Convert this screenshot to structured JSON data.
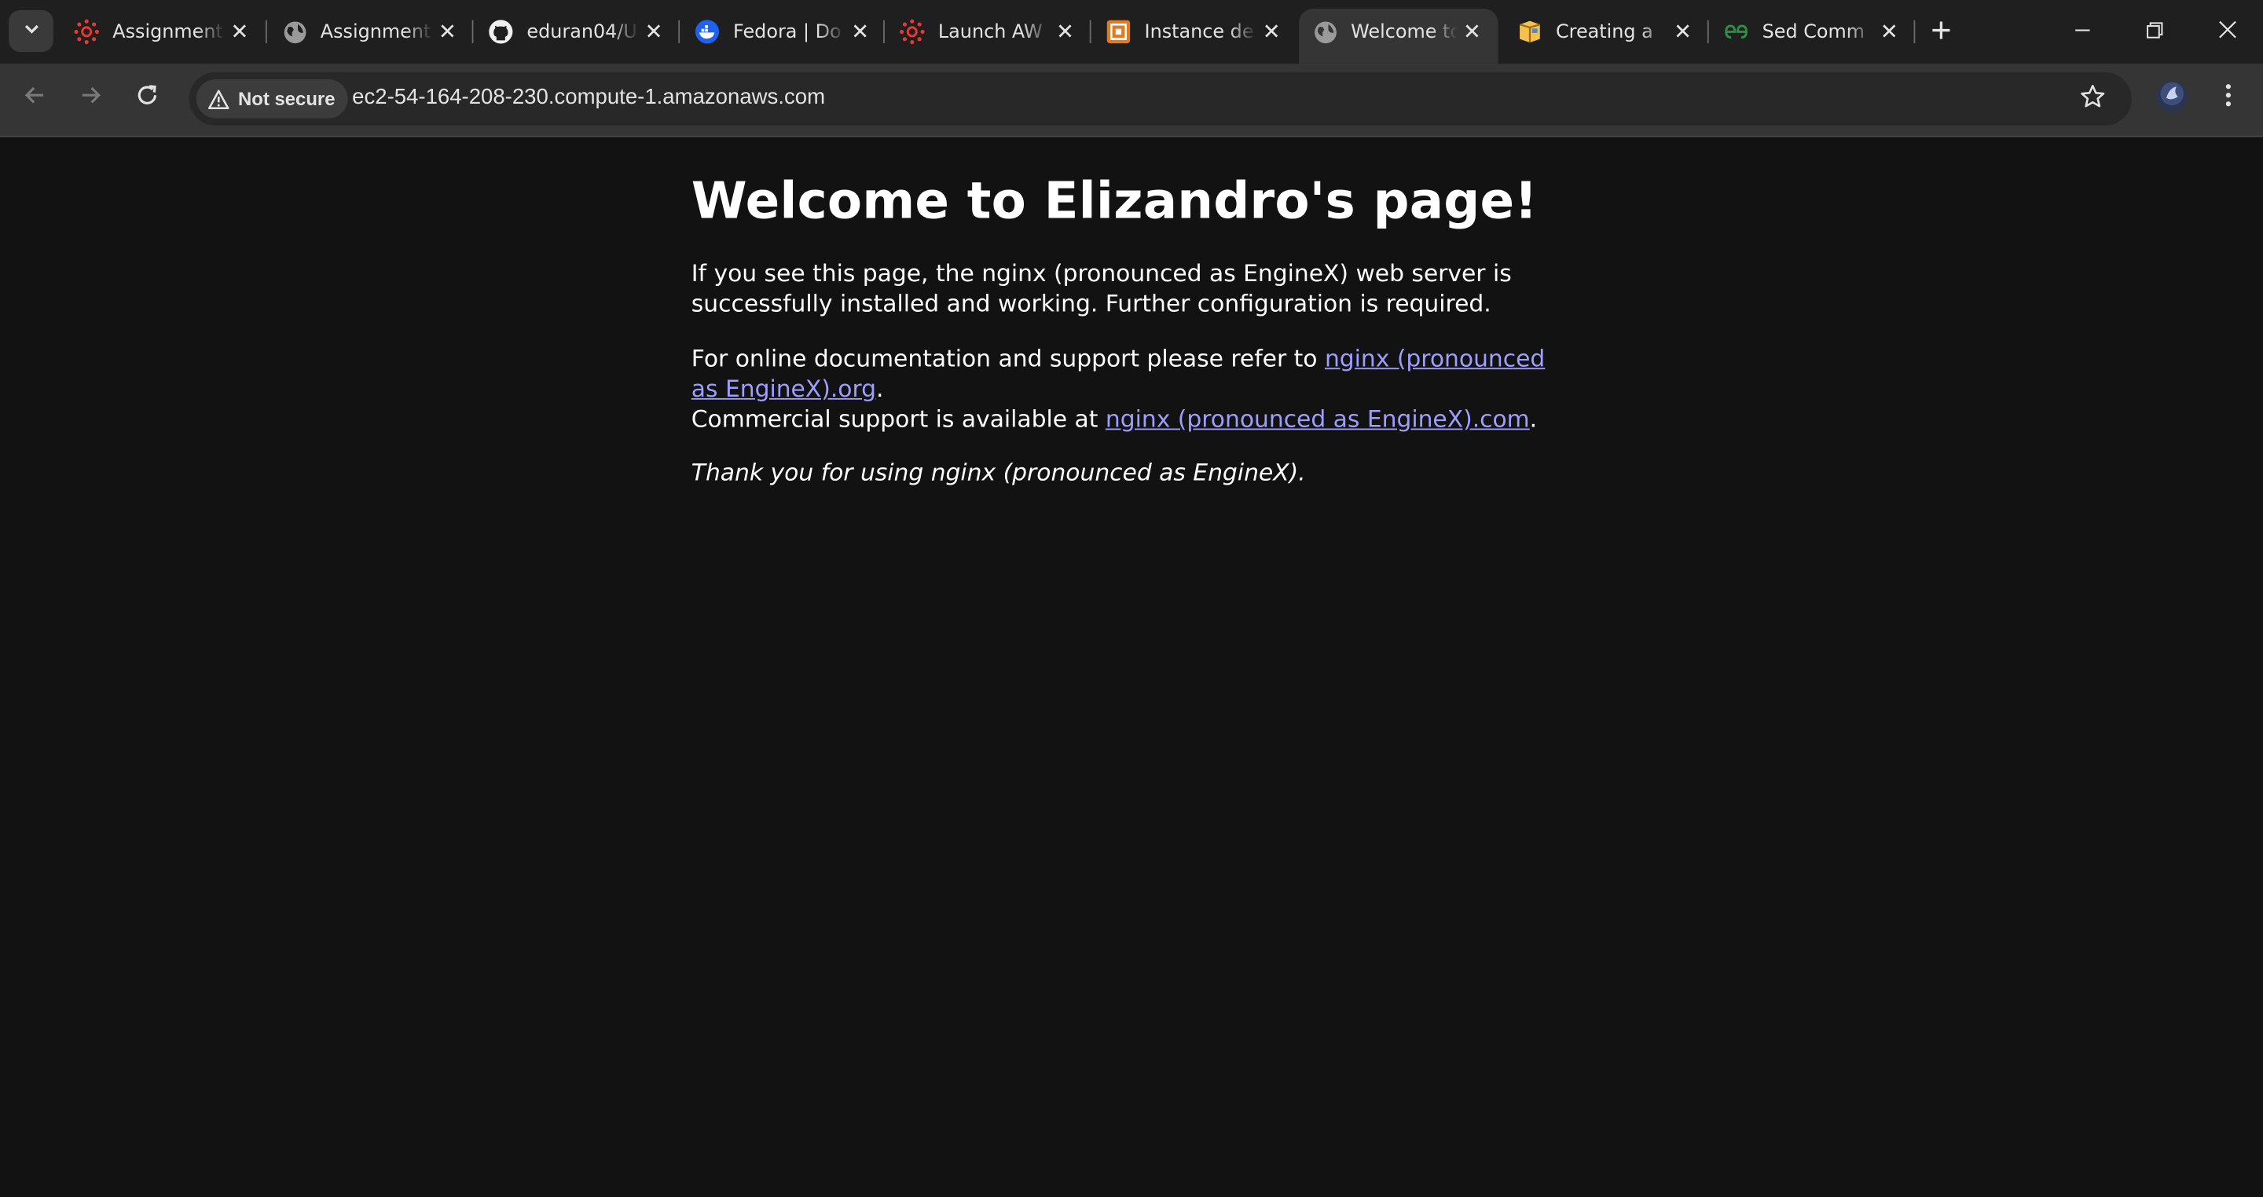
{
  "tabs": [
    {
      "title": "Assignment",
      "icon": "canvas-icon"
    },
    {
      "title": "Assignment",
      "icon": "globe-icon"
    },
    {
      "title": "eduran04/U",
      "icon": "github-icon"
    },
    {
      "title": "Fedora | Do",
      "icon": "docker-icon"
    },
    {
      "title": "Launch AW",
      "icon": "canvas-icon"
    },
    {
      "title": "Instance de",
      "icon": "aws-ec2-icon"
    },
    {
      "title": "Welcome to",
      "icon": "globe-icon",
      "active": true
    },
    {
      "title": "Creating a",
      "icon": "package-icon"
    },
    {
      "title": "Sed Comm",
      "icon": "geeksforgeeks-icon"
    }
  ],
  "toolbar": {
    "security_label": "Not secure",
    "url": "ec2-54-164-208-230.compute-1.amazonaws.com"
  },
  "page": {
    "heading": "Welcome to Elizandro's page!",
    "intro": "If you see this page, the nginx (pronounced as EngineX) web server is successfully installed and working. Further configuration is required.",
    "docs_prefix": "For online documentation and support please refer to ",
    "docs_link": "nginx (pronounced as EngineX).org",
    "docs_suffix": ".",
    "commercial_prefix": "Commercial support is available at ",
    "commercial_link": "nginx (pronounced as EngineX).com",
    "commercial_suffix": ".",
    "thanks": "Thank you for using nginx (pronounced as EngineX)."
  },
  "colors": {
    "page_background": "#121212",
    "link": "#9e9eff",
    "toolbar": "#353535",
    "tabstrip": "#1f1f1f"
  }
}
